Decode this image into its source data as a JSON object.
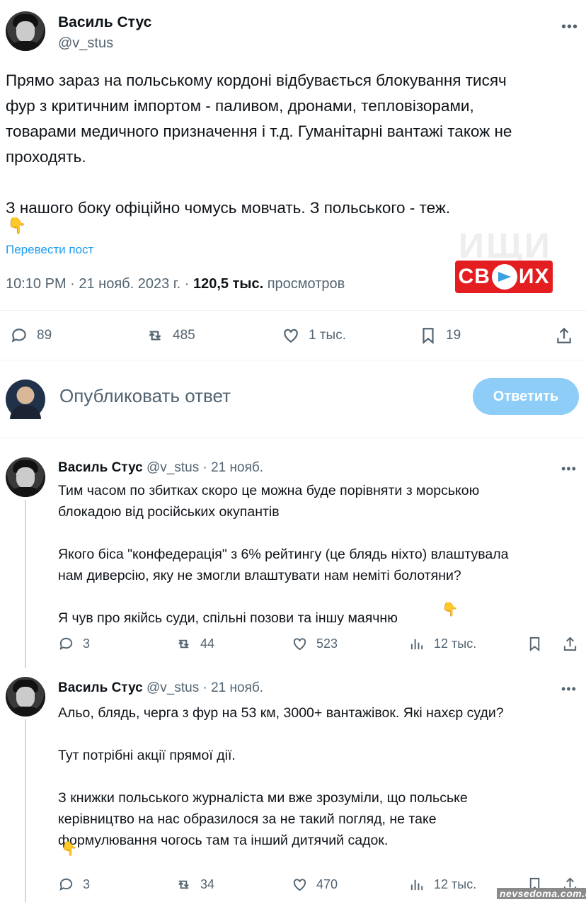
{
  "tweet": {
    "author_name": "Василь Стус",
    "author_handle": "@v_stus",
    "more": "•••",
    "text": "Прямо зараз на польському кордоні відбувається блокування тисяч\nфур з критичним імпортом - паливом, дронами, тепловізорами,\nтоварами медичного призначення і т.д. Гуманітарні вантажі також не\nпроходять.\n\nЗ нашого боку офіційно чомусь мовчать. З польського - теж.",
    "emoji": "👇",
    "translate": "Перевести пост",
    "time": "10:10 PM · 21 нояб. 2023 г. · ",
    "views_count": "120,5 тыс.",
    "views_label": " просмотров",
    "stats": {
      "replies": "89",
      "retweets": "485",
      "likes": "1 тыс.",
      "bookmarks": "19"
    }
  },
  "watermark": {
    "top": "ИЩИ",
    "badge_left": "СВ",
    "badge_right": "ИХ"
  },
  "reply_box": {
    "placeholder": "Опубликовать ответ",
    "button": "Ответить"
  },
  "replies": [
    {
      "name": "Василь Стус",
      "handle": " @v_stus · 21 нояб.",
      "text": "Тим часом по збитках скоро це можна буде порівняти з морською\nблокадою від російських окупантів\n\nЯкого біса \"конфедерація\" з 6% рейтингу (це блядь ніхто) влаштувала\nнам диверсію, яку не змогли влаштувати нам неміті болотяни?\n\nЯ чув про якійсь суди, спільні позови та іншу маячню",
      "emoji": "👇",
      "stats": {
        "replies": "3",
        "retweets": "44",
        "likes": "523",
        "views": "12 тыс."
      }
    },
    {
      "name": "Василь Стус",
      "handle": " @v_stus · 21 нояб.",
      "text": "Альо, блядь, черга з фур на 53 км, 3000+ вантажівок. Які нахєр суди?\n\nТут потрібні акції прямої дії.\n\nЗ книжки польського журналіста ми вже зрозуміли, що польське\nкерівництво на нас образилося за не такий погляд, не таке\nформулювання чогось там та інший дитячий садок.",
      "emoji": "👇",
      "stats": {
        "replies": "3",
        "retweets": "34",
        "likes": "470",
        "views": "12 тыс."
      }
    }
  ],
  "site_watermark": "nevsedoma.com.ua"
}
